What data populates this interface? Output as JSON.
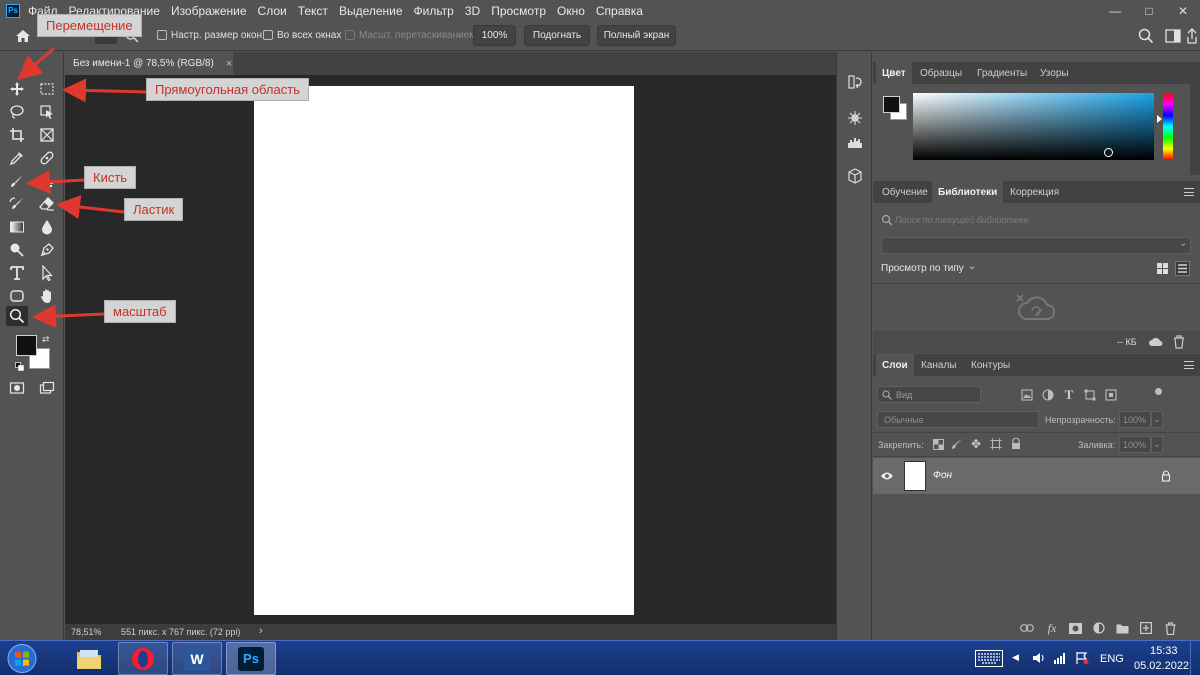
{
  "app": {
    "logo": "Ps"
  },
  "menu": [
    "Файл",
    "Редактирование",
    "Изображение",
    "Слои",
    "Текст",
    "Выделение",
    "Фильтр",
    "3D",
    "Просмотр",
    "Окно",
    "Справка"
  ],
  "window_controls": {
    "minimize": "—",
    "maximize": "□",
    "close": "✕"
  },
  "options_bar": {
    "resize_windows": "Настр. размер окон",
    "all_windows": "Во всех окнах",
    "scrubby_zoom": "Масшт. перетаскиванием",
    "zoom_100": "100%",
    "fit_screen": "Подогнать",
    "fill_screen": "Полный экран"
  },
  "document": {
    "tab_title": "Без имени-1 @ 78,5% (RGB/8)",
    "tab_close": "×",
    "zoom": "78,51%",
    "size_info": "551 пикс. x 767 пикс. (72 ppi)",
    "status_arrow": "›"
  },
  "annotations": {
    "move": "Перемещение",
    "marquee": "Прямоугольная область",
    "brush": "Кисть",
    "eraser": "Ластик",
    "zoom": "масштаб"
  },
  "color_panel": {
    "tabs": [
      "Цвет",
      "Образцы",
      "Градиенты",
      "Узоры"
    ],
    "foreground": "#111111",
    "background": "#ffffff",
    "hue_color": "#1aa3e8"
  },
  "libraries_panel": {
    "tabs": [
      "Обучение",
      "Библиотеки",
      "Коррекция"
    ],
    "search_placeholder": "Поиск по текущей библиотеке",
    "view_by": "Просмотр по типу",
    "storage": "-- КБ"
  },
  "layers_panel": {
    "tabs": [
      "Слои",
      "Каналы",
      "Контуры"
    ],
    "filter_placeholder": "Вид",
    "blend_mode": "Обычные",
    "opacity_label": "Непрозрачность:",
    "opacity_value": "100%",
    "lock_label": "Закрепить:",
    "fill_label": "Заливка:",
    "fill_value": "100%",
    "layers": [
      {
        "name": "Фон"
      }
    ]
  },
  "taskbar": {
    "time": "15:33",
    "date": "05.02.2022",
    "language": "ENG",
    "word_label": "W",
    "ps_label": "Ps"
  }
}
